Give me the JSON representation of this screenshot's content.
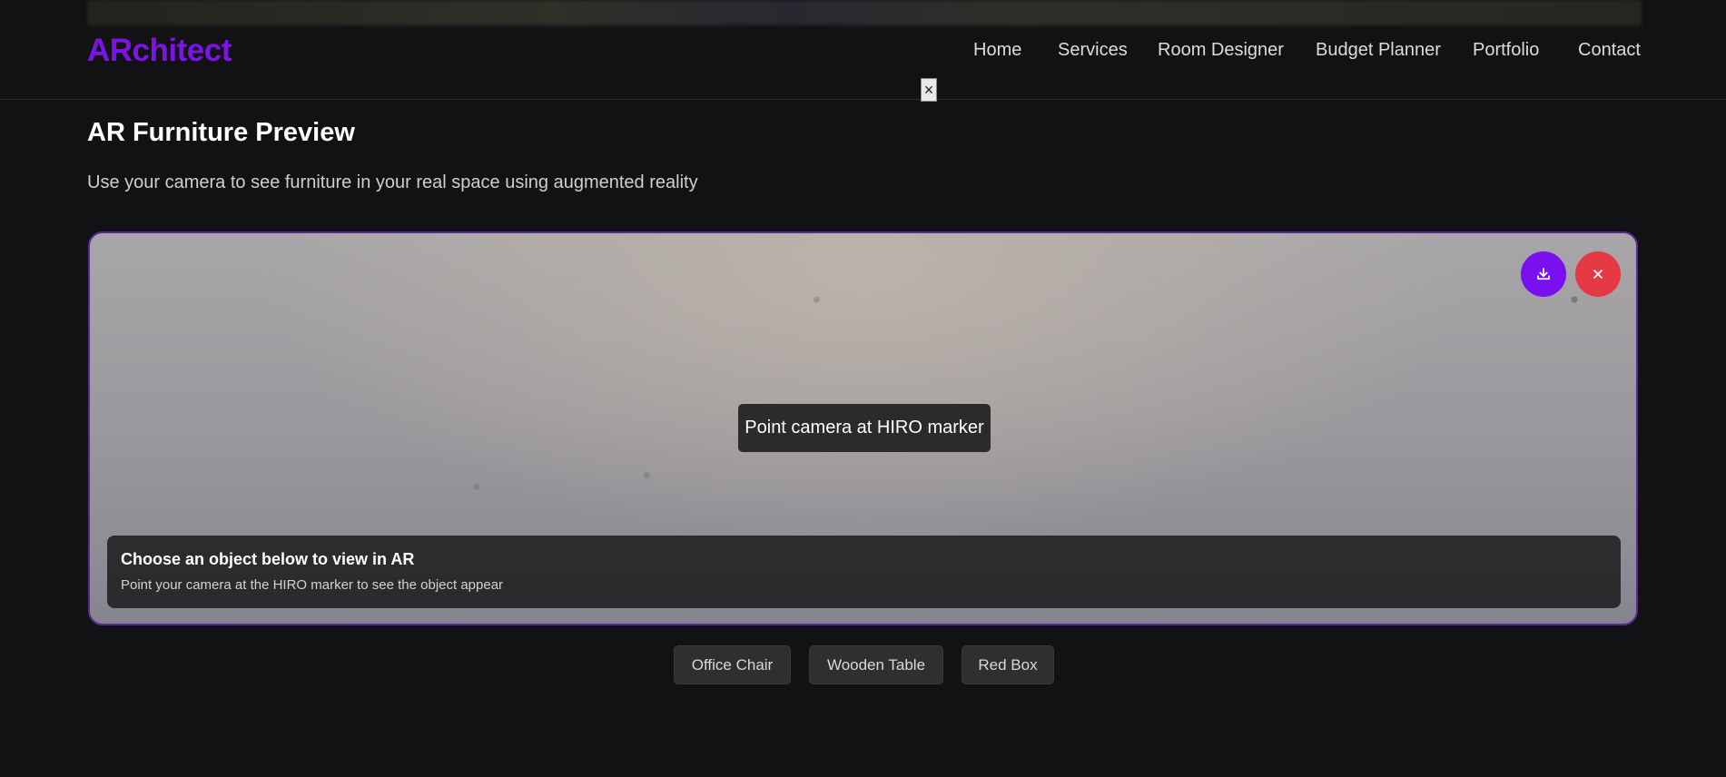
{
  "brand": {
    "logo": "ARchitect",
    "accent_color": "#7c12e6"
  },
  "nav": {
    "close_icon": "close-icon",
    "items": [
      {
        "label": "Home"
      },
      {
        "label": "Services"
      },
      {
        "label": "Room Designer"
      },
      {
        "label": "Budget Planner"
      },
      {
        "label": "Portfolio"
      },
      {
        "label": "Contact"
      }
    ]
  },
  "page": {
    "title": "AR Furniture Preview",
    "subtitle": "Use your camera to see furniture in your real space using augmented reality"
  },
  "ar_view": {
    "marker_hint": "Point camera at HIRO marker",
    "download_icon": "download-icon",
    "close_icon": "close-icon",
    "download_color": "#7a0ff0",
    "close_color": "#e53a44",
    "info_title": "Choose an object below to view in AR",
    "info_text": "Point your camera at the HIRO marker to see the object appear"
  },
  "objects": [
    {
      "label": "Office Chair"
    },
    {
      "label": "Wooden Table"
    },
    {
      "label": "Red Box"
    }
  ]
}
